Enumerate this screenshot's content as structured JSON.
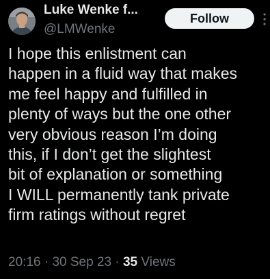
{
  "author": {
    "display_name": "Luke Wenke f...",
    "handle": "@LMWenke"
  },
  "follow_button": {
    "label": "Follow"
  },
  "tweet": {
    "lines": [
      "I hope this enlistment can",
      "happen in a fluid way that makes",
      "me feel happy and fulfilled in",
      "plenty of ways but the one other",
      "very obvious reason I’m doing",
      "this, if I don’t get the slightest",
      "bit of explanation or something",
      "I WILL permanently tank private",
      "firm ratings without regret"
    ]
  },
  "meta": {
    "time": "20:16",
    "separator": " · ",
    "date": "30 Sep 23",
    "views_count": "35",
    "views_label": " Views"
  },
  "icons": {
    "avatar": "avatar-portrait",
    "more": "more-dots-icon"
  },
  "colors": {
    "background": "#000000",
    "text_primary": "#e7e9ea",
    "text_secondary": "#71767b",
    "follow_bg": "#eff3f4",
    "follow_text": "#0f1419"
  }
}
